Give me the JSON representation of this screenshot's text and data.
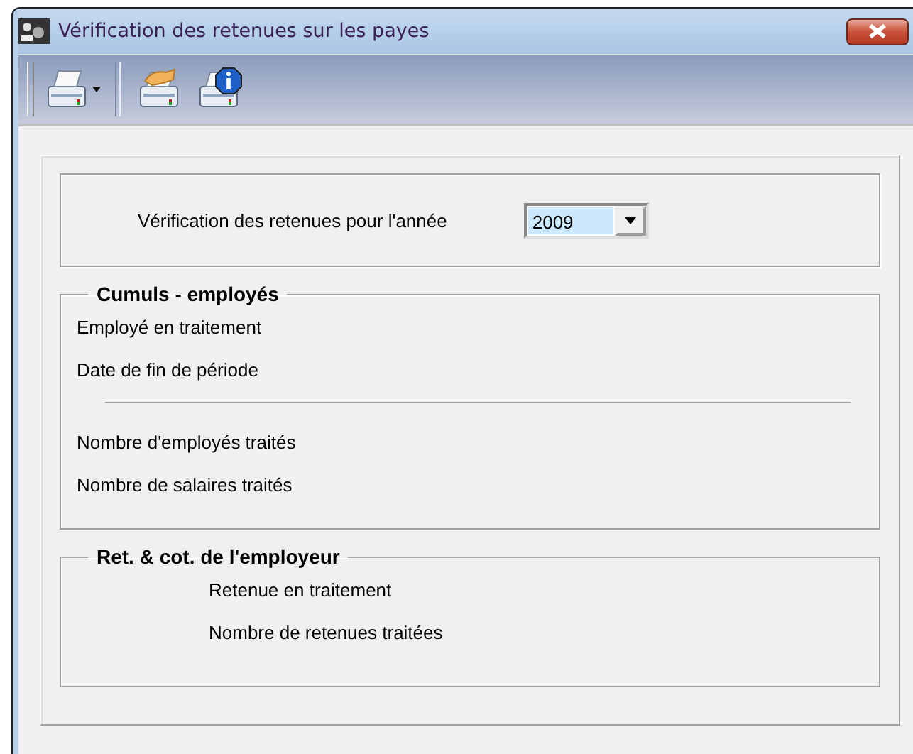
{
  "window": {
    "title": "Vérification des retenues sur les payes"
  },
  "year_selector": {
    "label": "Vérification des retenues pour l'année",
    "value": "2009"
  },
  "groups": [
    {
      "title": "Cumuls - employés",
      "items": [
        {
          "kind": "text",
          "label": "Employé en traitement"
        },
        {
          "kind": "text",
          "label": "Date de fin de période"
        },
        {
          "kind": "divider"
        },
        {
          "kind": "text",
          "label": "Nombre d'employés traités"
        },
        {
          "kind": "text",
          "label": "Nombre de salaires traités"
        }
      ]
    },
    {
      "title": "Ret. & cot. de l'employeur",
      "items": [
        {
          "kind": "text",
          "label": "Retenue en traitement"
        },
        {
          "kind": "text",
          "label": "Nombre de retenues traitées"
        }
      ]
    }
  ]
}
